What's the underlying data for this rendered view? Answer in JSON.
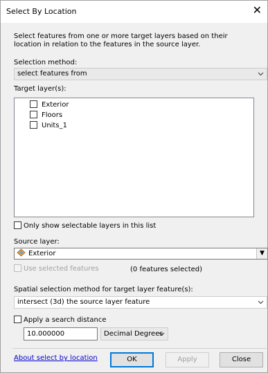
{
  "window": {
    "title": "Select By Location",
    "close_glyph": "✕"
  },
  "description": "Select features from one or more target layers based on their location in relation to the features in the source layer.",
  "selection_method": {
    "label": "Selection method:",
    "value": "select features from"
  },
  "target_layers": {
    "label": "Target layer(s):",
    "items": [
      {
        "label": "Exterior",
        "checked": false
      },
      {
        "label": "Floors",
        "checked": false
      },
      {
        "label": "Units_1",
        "checked": false
      }
    ]
  },
  "only_selectable": {
    "label": "Only show selectable layers in this list",
    "checked": false
  },
  "source_layer": {
    "label": "Source layer:",
    "value": "Exterior",
    "icon": "polygon-layer-icon"
  },
  "use_selected": {
    "label": "Use selected features",
    "checked": false,
    "enabled": false,
    "count_text": "(0 features selected)"
  },
  "spatial_method": {
    "label": "Spatial selection method for target layer feature(s):",
    "value": "intersect (3d) the source layer feature"
  },
  "search_distance": {
    "label": "Apply a search distance",
    "checked": false,
    "value": "10.000000",
    "units": "Decimal Degrees"
  },
  "footer": {
    "link": "About select by location",
    "ok": "OK",
    "apply": "Apply",
    "close": "Close"
  },
  "colors": {
    "link": "#0000cc",
    "default_button_border": "#0078d7"
  }
}
